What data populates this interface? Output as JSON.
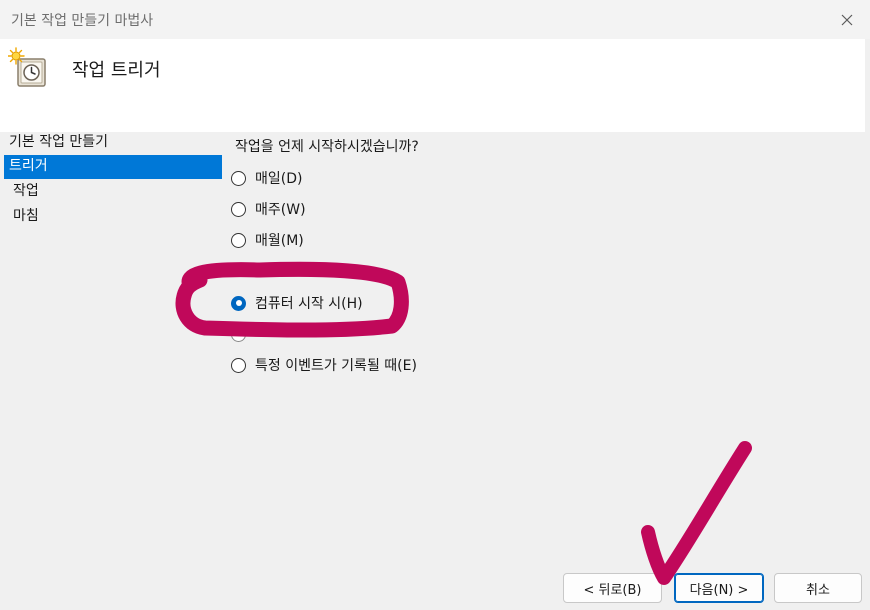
{
  "window": {
    "title": "기본 작업 만들기 마법사"
  },
  "header": {
    "title": "작업 트리거",
    "icon": "clock-wizard-icon"
  },
  "sidebar": {
    "items": [
      {
        "label": "기본 작업 만들기"
      },
      {
        "label": "트리거",
        "selected": true
      },
      {
        "label": "작업"
      },
      {
        "label": "마침"
      }
    ]
  },
  "main": {
    "question": "작업을 언제 시작하시겠습니까?",
    "options": [
      {
        "label": "매일(D)",
        "checked": false
      },
      {
        "label": "매주(W)",
        "checked": false
      },
      {
        "label": "매월(M)",
        "checked": false
      },
      {
        "label": "컴퓨터 시작 시(H)",
        "checked": true
      },
      {
        "label": "특정 이벤트가 기록될 때(E)",
        "checked": false
      }
    ]
  },
  "buttons": {
    "back": "< 뒤로(B)",
    "next": "다음(N) >",
    "cancel": "취소"
  },
  "colors": {
    "selection": "#0078d7",
    "radio_accent": "#0067c0",
    "annotation": "#c0085a"
  }
}
